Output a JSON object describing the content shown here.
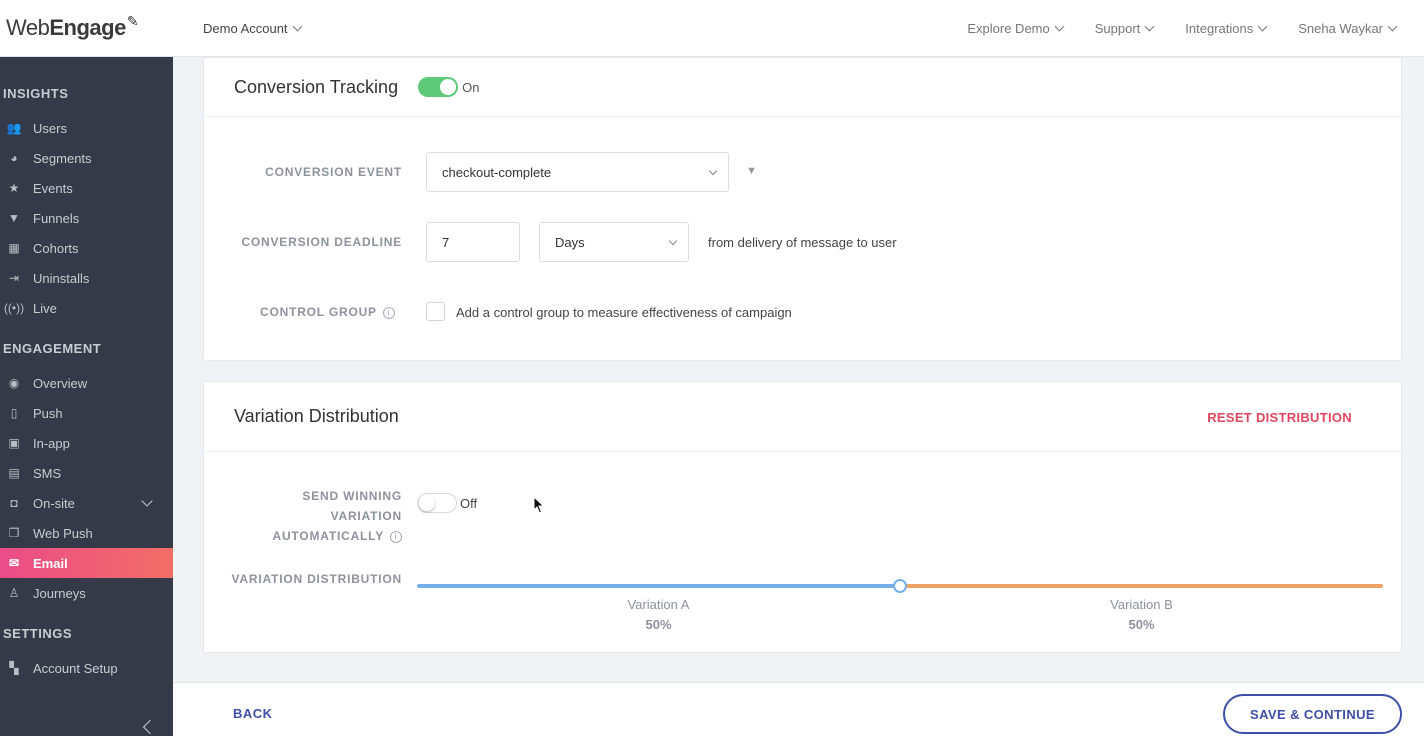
{
  "brand": {
    "part1": "Web",
    "part2": "Engage"
  },
  "header": {
    "account": "Demo Account",
    "links": [
      "Explore Demo",
      "Support",
      "Integrations",
      "Sneha Waykar"
    ]
  },
  "sidebar": {
    "sections": [
      "INSIGHTS",
      "ENGAGEMENT",
      "SETTINGS"
    ],
    "insights": [
      "Users",
      "Segments",
      "Events",
      "Funnels",
      "Cohorts",
      "Uninstalls",
      "Live"
    ],
    "engagement": [
      "Overview",
      "Push",
      "In-app",
      "SMS",
      "On-site",
      "Web Push",
      "Email",
      "Journeys"
    ],
    "settings": [
      "Account Setup"
    ],
    "active": "Email"
  },
  "conversion": {
    "title": "Conversion Tracking",
    "toggle_label": "On",
    "event_label": "CONVERSION EVENT",
    "event_value": "checkout-complete",
    "deadline_label": "CONVERSION DEADLINE",
    "deadline_value": "7",
    "deadline_unit": "Days",
    "deadline_suffix": "from delivery of message to user",
    "control_label": "CONTROL GROUP",
    "control_text": "Add a control group to measure effectiveness of campaign"
  },
  "variation": {
    "title": "Variation Distribution",
    "reset_label": "RESET DISTRIBUTION",
    "send_label_1": "SEND WINNING",
    "send_label_2": "VARIATION",
    "send_label_3": "AUTOMATICALLY",
    "toggle_label": "Off",
    "distribution_label": "VARIATION DISTRIBUTION",
    "split_fraction": 0.5,
    "variants": [
      {
        "name": "Variation A",
        "pct": "50%"
      },
      {
        "name": "Variation B",
        "pct": "50%"
      }
    ]
  },
  "footer": {
    "back": "BACK",
    "save": "SAVE & CONTINUE"
  },
  "colors": {
    "accent": "#3d4fa8",
    "active": "#ea4c89",
    "on": "#5ec97a",
    "varA": "#75b1e8",
    "varB": "#f1a262",
    "reset": "#e0475f"
  }
}
